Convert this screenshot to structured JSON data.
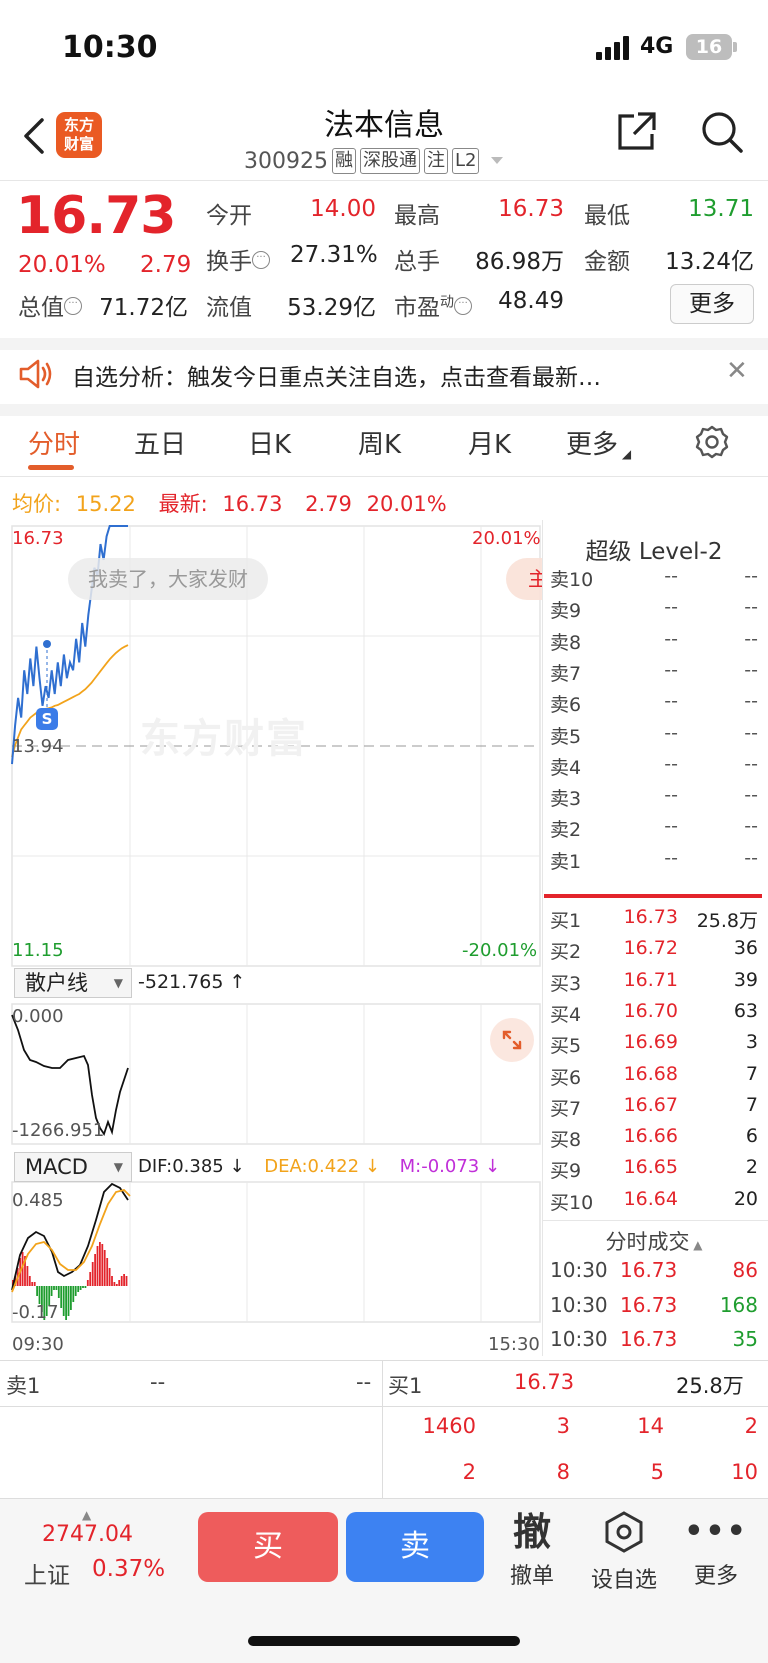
{
  "status": {
    "time": "10:30",
    "network": "4G",
    "battery": "16"
  },
  "header": {
    "title": "法本信息",
    "code": "300925",
    "tags": [
      "融",
      "深股通",
      "注",
      "L2"
    ],
    "logo_text": "东方财富"
  },
  "quote": {
    "price": "16.73",
    "pct": "20.01%",
    "change": "2.79",
    "open_label": "今开",
    "open": "14.00",
    "high_label": "最高",
    "high": "16.73",
    "low_label": "最低",
    "low": "13.71",
    "turnover_label": "换手",
    "turnover": "27.31%",
    "volume_label": "总手",
    "volume": "86.98万",
    "amount_label": "金额",
    "amount": "13.24亿",
    "mktcap_label": "总值",
    "mktcap": "71.72亿",
    "float_label": "流值",
    "float": "53.29亿",
    "pe_label": "市盈",
    "pe_sup": "动",
    "pe": "48.49",
    "more": "更多"
  },
  "notice": {
    "text": "自选分析：触发今日重点关注自选，点击查看最新…"
  },
  "tabs": [
    "分时",
    "五日",
    "日K",
    "周K",
    "月K",
    "更多"
  ],
  "info": {
    "avg_label": "均价:",
    "avg": "15.22",
    "latest_label": "最新:",
    "latest": "16.73",
    "chg": "2.79",
    "pct": "20.01%"
  },
  "chart": {
    "y_top": "16.73",
    "pct_top": "20.01%",
    "y_mid": "13.94",
    "y_bot": "11.15",
    "pct_bot": "-20.01%",
    "comment": "我卖了，大家发财",
    "comment2": "主",
    "watermark": "东方财富",
    "s_badge": "S",
    "retail_label": "散户线",
    "retail_value": "-521.765 ↑",
    "retail_top": "0.000",
    "retail_bot": "-1266.951",
    "macd_label": "MACD",
    "dif": "DIF:0.385 ↓",
    "dea": "DEA:0.422 ↓",
    "m": "M:-0.073 ↓",
    "macd_top": "0.485",
    "macd_bot": "-0.17",
    "t_start": "09:30",
    "t_end": "15:30",
    "price_series": [
      13.71,
      14.2,
      14.55,
      14.3,
      14.9,
      14.6,
      15.05,
      14.7,
      15.2,
      14.8,
      14.45,
      14.7,
      14.55,
      14.9,
      14.6,
      15.0,
      14.7,
      15.1,
      14.8,
      15.0,
      14.9,
      15.3,
      15.0,
      15.5,
      15.2,
      15.6,
      15.9,
      16.2,
      16.1,
      16.5,
      16.3,
      16.6,
      16.73,
      16.73,
      16.73,
      16.73,
      16.73,
      16.73,
      16.73
    ],
    "avg_series": [
      13.8,
      13.95,
      14.05,
      14.15,
      14.2,
      14.25,
      14.3,
      14.33,
      14.36,
      14.38,
      14.4,
      14.41,
      14.42,
      14.43,
      14.45,
      14.46,
      14.48,
      14.5,
      14.52,
      14.54,
      14.56,
      14.58,
      14.6,
      14.63,
      14.66,
      14.7,
      14.74,
      14.79,
      14.84,
      14.89,
      14.94,
      14.99,
      15.04,
      15.08,
      15.12,
      15.15,
      15.18,
      15.2,
      15.22
    ]
  },
  "level2": {
    "title": "超级 Level-2",
    "asks": [
      {
        "label": "卖10",
        "price": "--",
        "vol": "--"
      },
      {
        "label": "卖9",
        "price": "--",
        "vol": "--"
      },
      {
        "label": "卖8",
        "price": "--",
        "vol": "--"
      },
      {
        "label": "卖7",
        "price": "--",
        "vol": "--"
      },
      {
        "label": "卖6",
        "price": "--",
        "vol": "--"
      },
      {
        "label": "卖5",
        "price": "--",
        "vol": "--"
      },
      {
        "label": "卖4",
        "price": "--",
        "vol": "--"
      },
      {
        "label": "卖3",
        "price": "--",
        "vol": "--"
      },
      {
        "label": "卖2",
        "price": "--",
        "vol": "--"
      },
      {
        "label": "卖1",
        "price": "--",
        "vol": "--"
      }
    ],
    "bids": [
      {
        "label": "买1",
        "price": "16.73",
        "vol": "25.8万"
      },
      {
        "label": "买2",
        "price": "16.72",
        "vol": "36"
      },
      {
        "label": "买3",
        "price": "16.71",
        "vol": "39"
      },
      {
        "label": "买4",
        "price": "16.70",
        "vol": "63"
      },
      {
        "label": "买5",
        "price": "16.69",
        "vol": "3"
      },
      {
        "label": "买6",
        "price": "16.68",
        "vol": "7"
      },
      {
        "label": "买7",
        "price": "16.67",
        "vol": "7"
      },
      {
        "label": "买8",
        "price": "16.66",
        "vol": "6"
      },
      {
        "label": "买9",
        "price": "16.65",
        "vol": "2"
      },
      {
        "label": "买10",
        "price": "16.64",
        "vol": "20"
      }
    ],
    "ticks_title": "分时成交",
    "ticks": [
      {
        "time": "10:30",
        "price": "16.73",
        "vol": "86"
      },
      {
        "time": "10:30",
        "price": "16.73",
        "vol": "168"
      },
      {
        "time": "10:30",
        "price": "16.73",
        "vol": "35"
      }
    ]
  },
  "orders": {
    "sell_label": "卖1",
    "sell_price": "--",
    "sell_vol": "--",
    "buy_label": "买1",
    "buy_price": "16.73",
    "buy_vol": "25.8万",
    "queue_row1": [
      "1460",
      "3",
      "14",
      "2"
    ],
    "queue_row2": [
      "2",
      "8",
      "5",
      "10"
    ]
  },
  "footer": {
    "index_value": "2747.04",
    "index_name": "上证",
    "index_pct": "0.37%",
    "buy": "买",
    "sell": "卖",
    "cancel_icon": "撤",
    "cancel": "撤单",
    "watch": "设自选",
    "more": "更多"
  }
}
